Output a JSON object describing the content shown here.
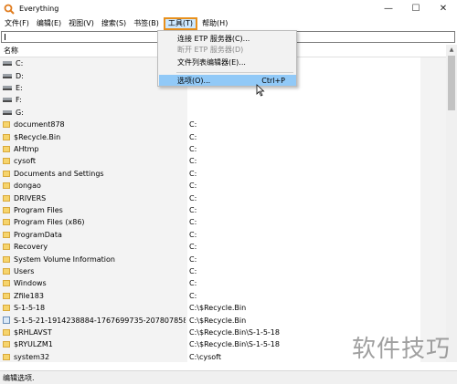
{
  "window": {
    "title": "Everything",
    "controls": {
      "minimize": "—",
      "maximize": "☐",
      "close": "✕"
    }
  },
  "menubar": {
    "items": [
      {
        "label": "文件(F)"
      },
      {
        "label": "编辑(E)"
      },
      {
        "label": "视图(V)"
      },
      {
        "label": "搜索(S)"
      },
      {
        "label": "书签(B)"
      },
      {
        "label": "工具(T)"
      },
      {
        "label": "帮助(H)"
      }
    ]
  },
  "search": {
    "value": ""
  },
  "header": {
    "name_col": "名称"
  },
  "tools_menu": {
    "items": [
      {
        "label": "连接 ETP 服务器(C)...",
        "shortcut": ""
      },
      {
        "label": "断开 ETP 服务器(D)",
        "shortcut": ""
      },
      {
        "label": "文件列表编辑器(E)...",
        "shortcut": ""
      },
      {
        "label": "选项(O)...",
        "shortcut": "Ctrl+P"
      }
    ]
  },
  "rows": [
    {
      "name": "C:",
      "path": "",
      "icon": "drive-icon"
    },
    {
      "name": "D:",
      "path": "",
      "icon": "drive-icon"
    },
    {
      "name": "E:",
      "path": "",
      "icon": "drive-icon"
    },
    {
      "name": "F:",
      "path": "",
      "icon": "drive-icon"
    },
    {
      "name": "G:",
      "path": "",
      "icon": "drive-icon"
    },
    {
      "name": "document878",
      "path": "C:",
      "icon": "folder-icon"
    },
    {
      "name": "$Recycle.Bin",
      "path": "C:",
      "icon": "folder-icon"
    },
    {
      "name": "AHtmp",
      "path": "C:",
      "icon": "folder-icon"
    },
    {
      "name": "cysoft",
      "path": "C:",
      "icon": "folder-icon"
    },
    {
      "name": "Documents and Settings",
      "path": "C:",
      "icon": "folder-icon"
    },
    {
      "name": "dongao",
      "path": "C:",
      "icon": "folder-icon"
    },
    {
      "name": "DRIVERS",
      "path": "C:",
      "icon": "folder-icon"
    },
    {
      "name": "Program Files",
      "path": "C:",
      "icon": "folder-icon"
    },
    {
      "name": "Program Files (x86)",
      "path": "C:",
      "icon": "folder-icon"
    },
    {
      "name": "ProgramData",
      "path": "C:",
      "icon": "folder-icon"
    },
    {
      "name": "Recovery",
      "path": "C:",
      "icon": "folder-icon"
    },
    {
      "name": "System Volume Information",
      "path": "C:",
      "icon": "folder-icon"
    },
    {
      "name": "Users",
      "path": "C:",
      "icon": "folder-icon"
    },
    {
      "name": "Windows",
      "path": "C:",
      "icon": "folder-icon"
    },
    {
      "name": "Zfile183",
      "path": "C:",
      "icon": "folder-icon"
    },
    {
      "name": "S-1-5-18",
      "path": "C:\\$Recycle.Bin",
      "icon": "folder-icon"
    },
    {
      "name": "S-1-5-21-1914238884-1767699735-2078078589-...",
      "path": "C:\\$Recycle.Bin",
      "icon": "sid-icon"
    },
    {
      "name": "$RHLAVST",
      "path": "C:\\$Recycle.Bin\\S-1-5-18",
      "icon": "folder-icon"
    },
    {
      "name": "$RYULZM1",
      "path": "C:\\$Recycle.Bin\\S-1-5-18",
      "icon": "folder-icon"
    },
    {
      "name": "system32",
      "path": "C:\\cysoft",
      "icon": "folder-icon"
    }
  ],
  "status": {
    "text": "编辑选项."
  },
  "watermark": {
    "text": "软件技巧"
  },
  "colors": {
    "active_menu_border": "#e8901c",
    "highlight": "#91c9f7",
    "folder": "#f6d46c"
  }
}
